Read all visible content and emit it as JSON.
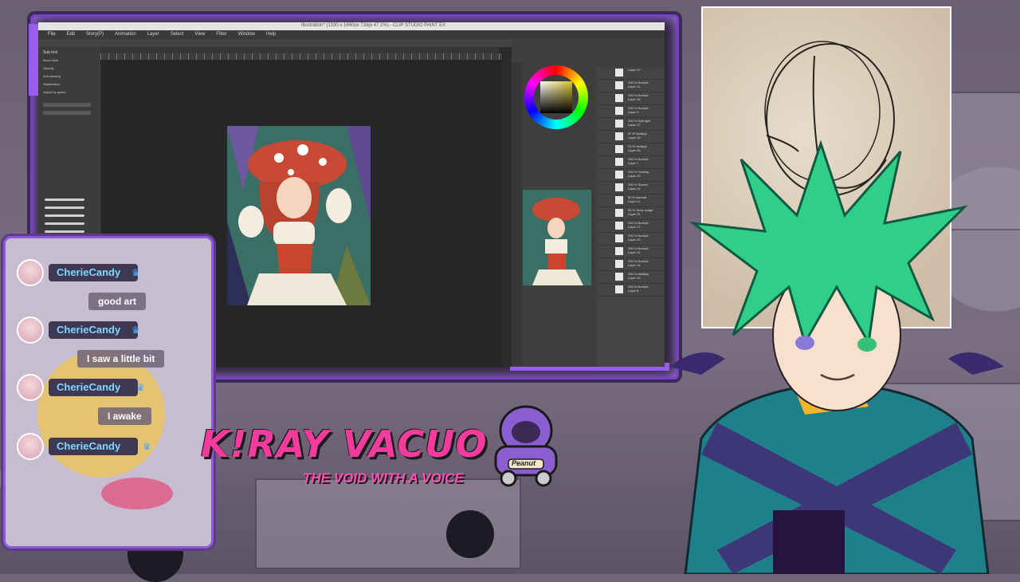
{
  "app": {
    "title": "Illustration* (1330 x 1660px 72dpi 47.1%) - CLIP STUDIO PAINT EX",
    "menu": [
      "File",
      "Edit",
      "Story(P)",
      "Animation",
      "Layer",
      "Select",
      "View",
      "Filter",
      "Window",
      "Help"
    ]
  },
  "left_panel": {
    "tool_title": "Sub tool",
    "props": [
      "Brush Size",
      "Opacity",
      "Anti-aliasing",
      "Stabilization",
      "Adjust by speed"
    ]
  },
  "layers": [
    {
      "name": "Layer 10",
      "mode": "100 % Normal"
    },
    {
      "name": "Layer 11",
      "mode": "100 % Normal"
    },
    {
      "name": "Layer 18",
      "mode": "100 % Normal"
    },
    {
      "name": "Layer 9",
      "mode": "100 % Normal"
    },
    {
      "name": "Layer 27",
      "mode": "100 % Soft light"
    },
    {
      "name": "Layer 16",
      "mode": "67 % Multiply"
    },
    {
      "name": "Layer 26",
      "mode": "23 % Multiply"
    },
    {
      "name": "Layer 7",
      "mode": "100 % Normal"
    },
    {
      "name": "Layer 25",
      "mode": "100 % Overlay"
    },
    {
      "name": "Layer 24",
      "mode": "100 % Screen"
    },
    {
      "name": "Layer 21",
      "mode": "50 % Normal"
    },
    {
      "name": "Layer 31",
      "mode": "33 % Glow dodge"
    },
    {
      "name": "Layer 17",
      "mode": "100 % Normal"
    },
    {
      "name": "Layer 20",
      "mode": "100 % Normal"
    },
    {
      "name": "Layer 12",
      "mode": "100 % Normal"
    },
    {
      "name": "Layer 14",
      "mode": "100 % Normal"
    },
    {
      "name": "Layer 15",
      "mode": "100 % Multiply"
    },
    {
      "name": "Layer 8",
      "mode": "100 % Normal"
    }
  ],
  "chat": {
    "messages": [
      {
        "user": "CherieCandy",
        "text": "good art"
      },
      {
        "user": "CherieCandy",
        "text": "I saw a little bit"
      },
      {
        "user": "CherieCandy",
        "text": "I awake"
      },
      {
        "user": "CherieCandy",
        "text": ""
      }
    ]
  },
  "branding": {
    "logo": "K!RAY VACUO",
    "subtitle": "THE VOID WITH A VOICE",
    "mascot": "Peanut"
  },
  "colors": {
    "accent": "#8d5bd6",
    "logo_pink": "#f23b9c",
    "chat_name": "#7fd8ff",
    "hair_green": "#2fcf8a"
  }
}
